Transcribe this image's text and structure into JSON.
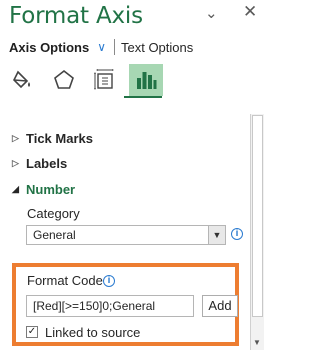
{
  "pane": {
    "title": "Format Axis",
    "dropdown_icon": "chevron-down-icon",
    "close_icon": "close-icon"
  },
  "tabs": {
    "axis_options": "Axis Options",
    "text_options": "Text Options"
  },
  "icon_tabs": [
    {
      "name": "fill-line-icon",
      "selected": false
    },
    {
      "name": "effects-pentagon-icon",
      "selected": false
    },
    {
      "name": "size-properties-icon",
      "selected": false
    },
    {
      "name": "axis-options-bar-chart-icon",
      "selected": true
    }
  ],
  "sections": {
    "tick_marks": "Tick Marks",
    "labels": "Labels",
    "number": "Number"
  },
  "number": {
    "category_label": "Category",
    "category_value": "General",
    "format_code_label": "Format Code",
    "format_code_value": "[Red][>=150]0;General",
    "add_button": "Add",
    "linked_label": "Linked to source",
    "linked_checked": true
  },
  "colors": {
    "accent_green": "#217346",
    "highlight_orange": "#ed7d31",
    "selected_tab_bg": "#a7d7b3"
  }
}
